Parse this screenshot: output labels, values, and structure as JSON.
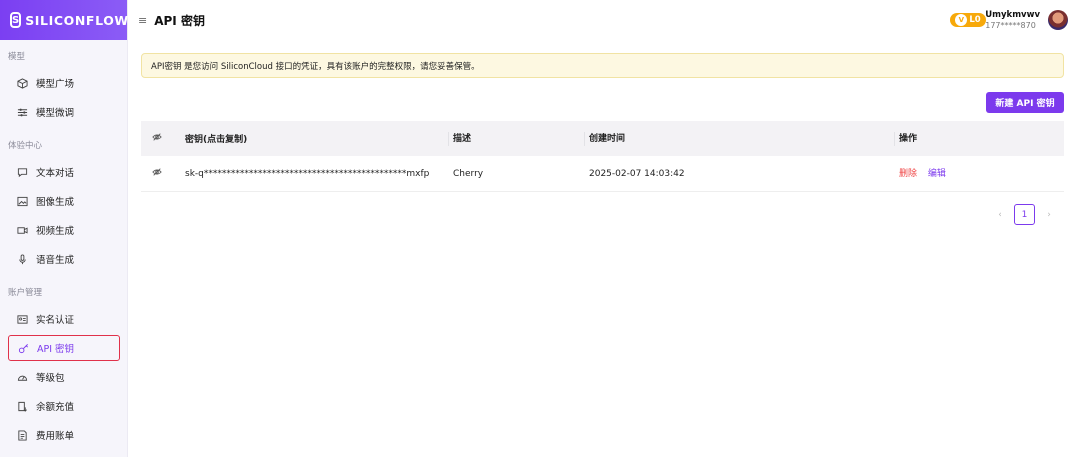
{
  "brand": {
    "name": "SILICONFLOW"
  },
  "sidebar": {
    "sections": [
      {
        "title": "模型"
      },
      {
        "title": "体验中心"
      },
      {
        "title": "账户管理"
      }
    ],
    "items": [
      {
        "label": "模型广场",
        "icon": "cube-icon"
      },
      {
        "label": "模型微调",
        "icon": "sliders-icon"
      },
      {
        "label": "文本对话",
        "icon": "chat-icon"
      },
      {
        "label": "图像生成",
        "icon": "image-icon"
      },
      {
        "label": "视频生成",
        "icon": "video-icon"
      },
      {
        "label": "语音生成",
        "icon": "microphone-icon"
      },
      {
        "label": "实名认证",
        "icon": "id-card-icon"
      },
      {
        "label": "API 密钥",
        "icon": "key-icon",
        "active": true
      },
      {
        "label": "等级包",
        "icon": "gauge-icon"
      },
      {
        "label": "余额充值",
        "icon": "recharge-icon"
      },
      {
        "label": "费用账单",
        "icon": "bill-icon"
      }
    ]
  },
  "header": {
    "title": "API 密钥",
    "level": "L0",
    "username": "Umykmvwv",
    "phone": "177*****870"
  },
  "notice": "API密钥 是您访问 SiliconCloud 接口的凭证，具有该账户的完整权限，请您妥善保管。",
  "actions": {
    "new_key": "新建 API 密钥"
  },
  "table": {
    "headers": [
      "密钥(点击复制)",
      "描述",
      "创建时间",
      "操作"
    ],
    "rows": [
      {
        "key": "sk-q*********************************************mxfp",
        "description": "Cherry",
        "created": "2025-02-07 14:03:42",
        "delete": "删除",
        "edit": "编辑"
      }
    ]
  },
  "pagination": {
    "current": "1",
    "prev": "‹",
    "next": "›"
  },
  "colors": {
    "accent": "#7c3aed",
    "danger": "#ef4444",
    "level": "#f7a90a"
  }
}
